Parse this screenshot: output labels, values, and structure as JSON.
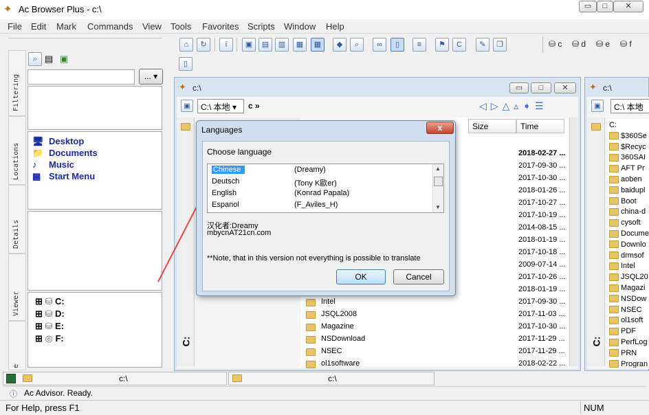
{
  "window": {
    "title": "Ac Browser Plus - c:\\",
    "controls": {
      "minimize": "▭",
      "maximize": "□",
      "close": "✕"
    }
  },
  "menu": [
    "File",
    "Edit",
    "Mark",
    "Commands",
    "View",
    "Tools",
    "Favorites",
    "Scripts",
    "Window",
    "Help"
  ],
  "toolbar": {
    "drives": [
      "c",
      "d",
      "e",
      "f"
    ],
    "view_icon": "list-view-icon"
  },
  "left_panel": {
    "tabs": [
      "Filtering",
      "Locations",
      "Details",
      "Viewer",
      "e"
    ],
    "filter_button": "...",
    "locations": [
      "Desktop",
      "Documents",
      "Music",
      "Start Menu"
    ],
    "drives": [
      "C:",
      "D:",
      "E:",
      "F:"
    ]
  },
  "pane_left": {
    "title": "c:\\",
    "path_combo": "C:\\ 本地",
    "nav_symbol": "c »",
    "side_letter": "C:",
    "columns": [
      "Size",
      "Time"
    ],
    "rows": [
      {
        "name": "",
        "time": "2018-02-27 ..."
      },
      {
        "name": "",
        "time": "2017-09-30 ..."
      },
      {
        "name": "",
        "time": "2017-10-30 ..."
      },
      {
        "name": "",
        "time": "2018-01-26 ..."
      },
      {
        "name": "",
        "time": "2017-10-27 ..."
      },
      {
        "name": "",
        "time": "2017-10-19 ..."
      },
      {
        "name": "",
        "time": "2014-08-15 ..."
      },
      {
        "name": "",
        "time": "2018-01-19 ..."
      },
      {
        "name": "",
        "time": "2017-10-18 ..."
      },
      {
        "name": "",
        "time": "2009-07-14 ..."
      },
      {
        "name": "",
        "time": "2017-10-26 ..."
      },
      {
        "name": "",
        "time": "2018-01-19 ..."
      },
      {
        "name": "Intel",
        "time": "2017-09-30 ..."
      },
      {
        "name": "JSQL2008",
        "time": "2017-11-03 ..."
      },
      {
        "name": "Magazine",
        "time": "2017-10-30 ..."
      },
      {
        "name": "NSDownload",
        "time": "2017-11-29 ..."
      },
      {
        "name": "NSEC",
        "time": "2017-11-29 ..."
      },
      {
        "name": "ol1software",
        "time": "2018-02-22 ..."
      }
    ]
  },
  "pane_right": {
    "title": "c:\\",
    "path_combo": "C:\\ 本地",
    "side_letter": "C:",
    "items": [
      "C:",
      "$360Se",
      "$Recyc",
      "360SAI",
      "AFT Pr",
      "aoben",
      "baidupl",
      "Boot",
      "china-d",
      "cysoft",
      "Docume",
      "Downlo",
      "drmsof",
      "Intel",
      "JSQL20",
      "Magazi",
      "NSDow",
      "NSEC",
      "ol1soft",
      "PDF",
      "PerfLog",
      "PRN",
      "Progran"
    ]
  },
  "dialog": {
    "title": "Languages",
    "close_label": "x",
    "prompt": "Choose language",
    "languages": [
      {
        "name": "Chinese",
        "translator": "(Dreamy)"
      },
      {
        "name": "Deutsch",
        "translator": "(Tony K歐er)"
      },
      {
        "name": "English",
        "translator": "(Konrad Papala)"
      },
      {
        "name": "Espanol",
        "translator": "(F_Aviles_H)"
      }
    ],
    "selected_language": "Chinese",
    "credit_line1": "汉化者:Dreamy",
    "credit_line2": "mbycnAT21cn.com",
    "note": "**Note, that in this version not everything is possible to translate",
    "ok": "OK",
    "cancel": "Cancel"
  },
  "bottom": {
    "left_path": "c:\\",
    "right_path": "c:\\",
    "advisor": "Ac Advisor. Ready.",
    "help": "For Help, press F1",
    "num": "NUM"
  },
  "colors": {
    "annotation_arrow": "#e8483e",
    "selection": "#3399ff",
    "location_text": "#1a2a9a",
    "pane_frame": "#d9e4f1"
  }
}
